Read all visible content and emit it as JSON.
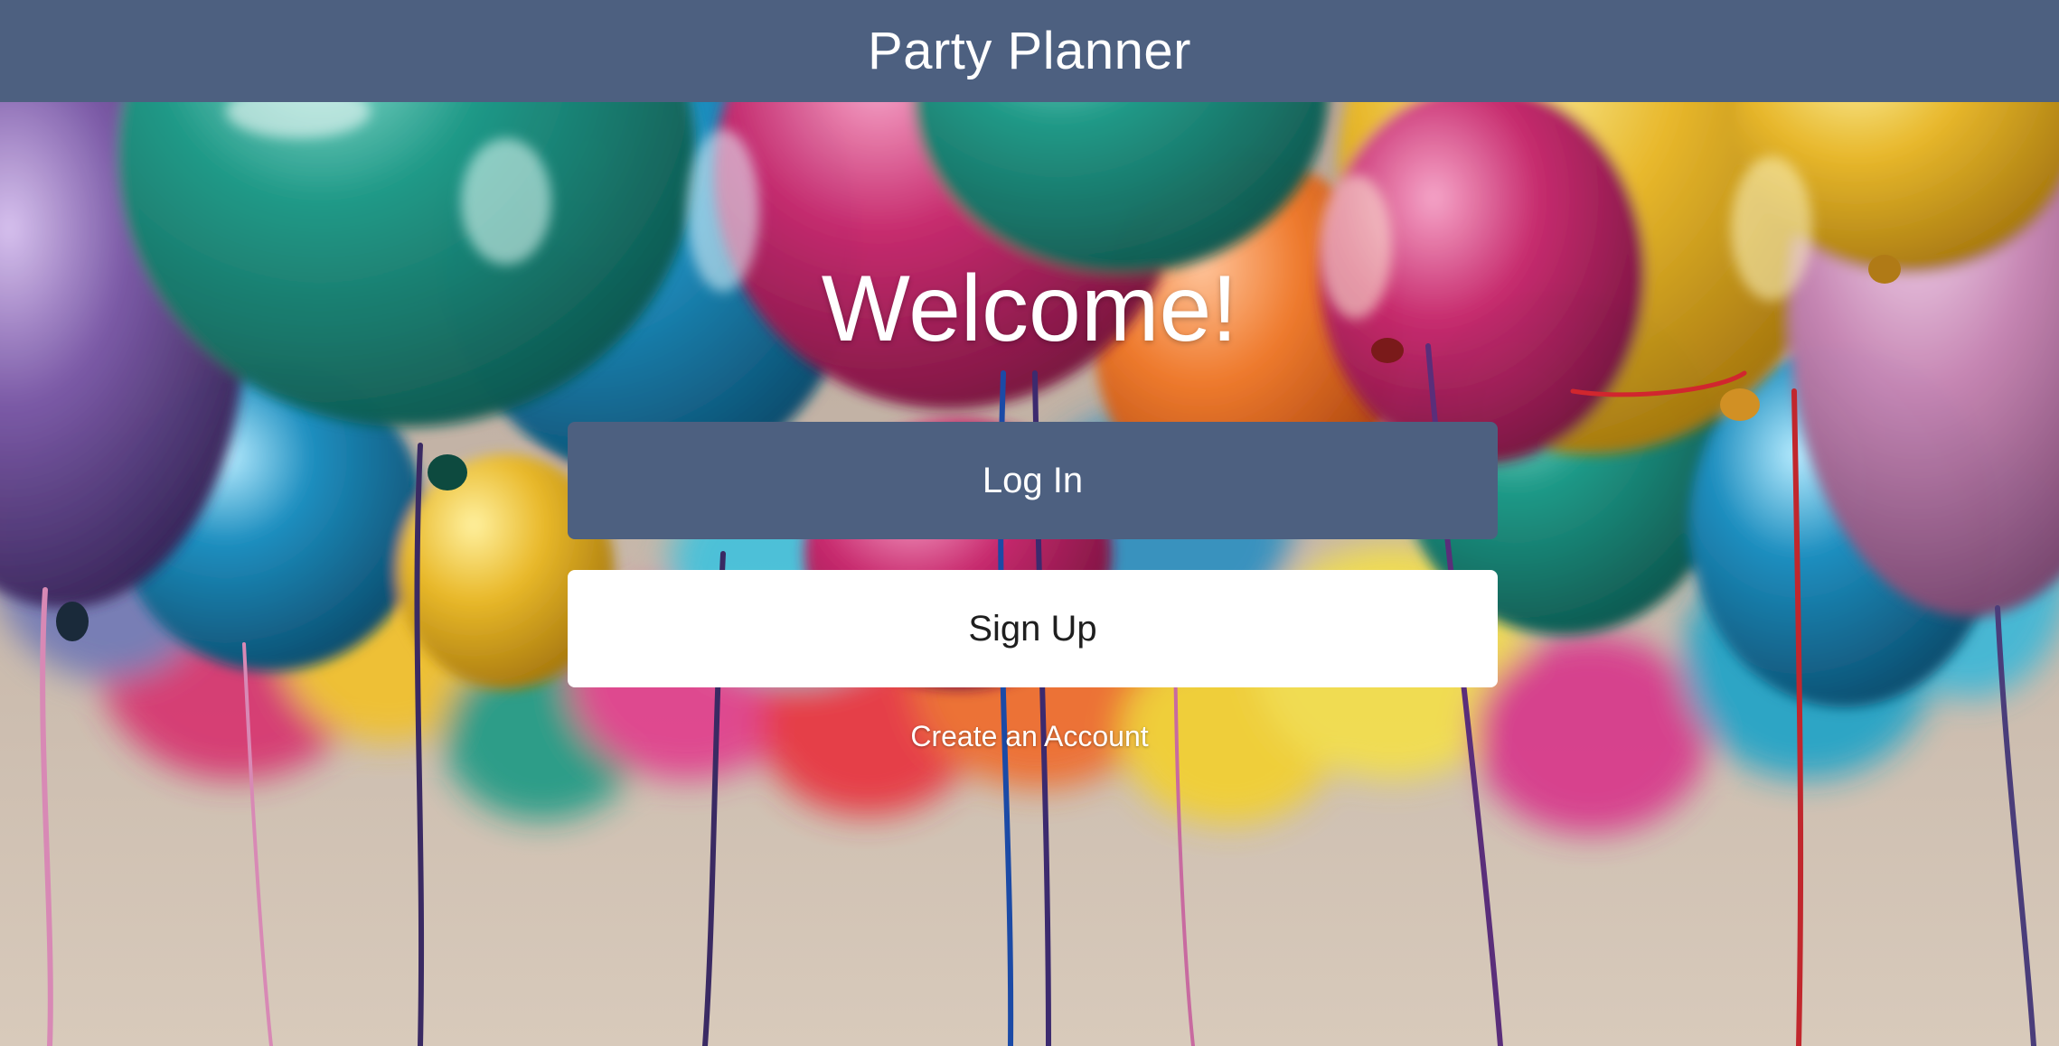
{
  "header": {
    "title": "Party Planner",
    "color": "#4d6080"
  },
  "hero": {
    "background": "colorful-balloons-photo"
  },
  "main": {
    "heading": "Welcome!",
    "login_label": "Log In",
    "signup_label": "Sign Up",
    "create_account_label": "Create an Account"
  }
}
